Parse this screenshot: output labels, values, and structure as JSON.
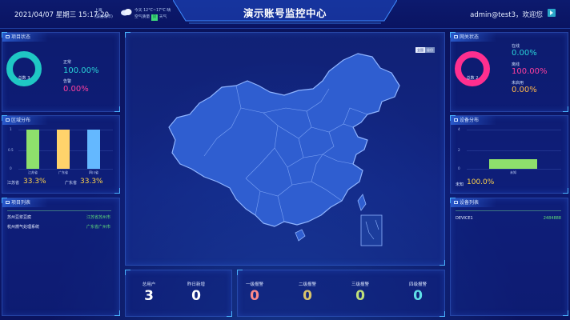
{
  "header": {
    "datetime": "2021/04/07 星期三 15:17:20",
    "location_line1": "上海",
    "location_line2": "(实验城市)",
    "weather_temp": "今天 12°C~17°C 晴",
    "air_quality_label": "空气质量",
    "air_quality_badge": "良",
    "weather_suffix": "天气",
    "title": "演示账号监控中心",
    "user_greeting": "admin@test3，欢迎您"
  },
  "project_status": {
    "title": "项目状态",
    "center_label": "总数 3",
    "normal_label": "正常",
    "normal_value": "100.00%",
    "alarm_label": "告警",
    "alarm_value": "0.00%",
    "ring_color": "#1fc7c4"
  },
  "region_dist": {
    "title": "区域分布",
    "y_ticks": [
      "1",
      "0.5",
      "0"
    ],
    "categories": [
      "江苏省",
      "广东省",
      "四川省"
    ],
    "values": [
      1,
      1,
      1
    ],
    "colors": [
      "#8ee06c",
      "#ffd36b",
      "#64b8ff"
    ],
    "pct_items": [
      {
        "label": "江苏省",
        "value": "33.3%"
      },
      {
        "label": "广东省",
        "value": "33.3%"
      }
    ]
  },
  "project_list": {
    "title": "项目列表",
    "rows": [
      {
        "name": "苏州豆浆豆腐",
        "region": "江苏省苏州市"
      },
      {
        "name": "杭州燃气处理系统",
        "region": "广东省广州市"
      }
    ]
  },
  "gateway_status": {
    "title": "网关状态",
    "center_label": "总数 2",
    "online_label": "在线",
    "online_value": "0.00%",
    "offline_label": "离线",
    "offline_value": "100.00%",
    "disabled_label": "未启用",
    "disabled_value": "0.00%",
    "ring_color": "#ff2f8f"
  },
  "device_dist": {
    "title": "设备分布",
    "y_ticks": [
      "4",
      "2",
      "0"
    ],
    "categories": [
      "未知"
    ],
    "values": [
      1
    ],
    "colors": [
      "#8ee06c"
    ],
    "pct_label": "未知",
    "pct_value": "100.0%"
  },
  "device_list": {
    "title": "设备列表",
    "rows": [
      {
        "name": "DEVICE1",
        "id": "2484888"
      }
    ]
  },
  "map": {
    "toggle_on": "全国",
    "toggle_off": "省份",
    "fill_color": "#2f5ed0"
  },
  "counters": {
    "users_label": "总用户",
    "users_value": "3",
    "today_label": "昨日新增",
    "today_value": "0",
    "alarms": [
      {
        "label": "一级报警",
        "value": "0"
      },
      {
        "label": "二级报警",
        "value": "0"
      },
      {
        "label": "三级报警",
        "value": "0"
      },
      {
        "label": "四级报警",
        "value": "0"
      }
    ]
  }
}
